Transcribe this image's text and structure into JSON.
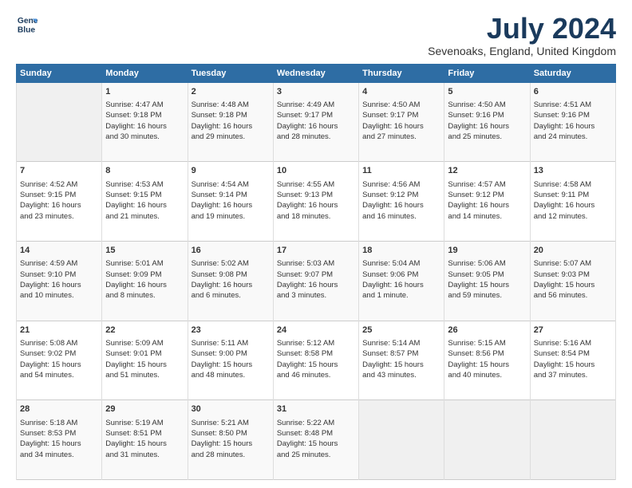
{
  "logo": {
    "line1": "General",
    "line2": "Blue"
  },
  "title": "July 2024",
  "subtitle": "Sevenoaks, England, United Kingdom",
  "header_days": [
    "Sunday",
    "Monday",
    "Tuesday",
    "Wednesday",
    "Thursday",
    "Friday",
    "Saturday"
  ],
  "weeks": [
    {
      "cells": [
        {
          "date": "",
          "content": "",
          "empty": true
        },
        {
          "date": "1",
          "content": "Sunrise: 4:47 AM\nSunset: 9:18 PM\nDaylight: 16 hours\nand 30 minutes."
        },
        {
          "date": "2",
          "content": "Sunrise: 4:48 AM\nSunset: 9:18 PM\nDaylight: 16 hours\nand 29 minutes."
        },
        {
          "date": "3",
          "content": "Sunrise: 4:49 AM\nSunset: 9:17 PM\nDaylight: 16 hours\nand 28 minutes."
        },
        {
          "date": "4",
          "content": "Sunrise: 4:50 AM\nSunset: 9:17 PM\nDaylight: 16 hours\nand 27 minutes."
        },
        {
          "date": "5",
          "content": "Sunrise: 4:50 AM\nSunset: 9:16 PM\nDaylight: 16 hours\nand 25 minutes."
        },
        {
          "date": "6",
          "content": "Sunrise: 4:51 AM\nSunset: 9:16 PM\nDaylight: 16 hours\nand 24 minutes."
        }
      ]
    },
    {
      "cells": [
        {
          "date": "7",
          "content": "Sunrise: 4:52 AM\nSunset: 9:15 PM\nDaylight: 16 hours\nand 23 minutes."
        },
        {
          "date": "8",
          "content": "Sunrise: 4:53 AM\nSunset: 9:15 PM\nDaylight: 16 hours\nand 21 minutes."
        },
        {
          "date": "9",
          "content": "Sunrise: 4:54 AM\nSunset: 9:14 PM\nDaylight: 16 hours\nand 19 minutes."
        },
        {
          "date": "10",
          "content": "Sunrise: 4:55 AM\nSunset: 9:13 PM\nDaylight: 16 hours\nand 18 minutes."
        },
        {
          "date": "11",
          "content": "Sunrise: 4:56 AM\nSunset: 9:12 PM\nDaylight: 16 hours\nand 16 minutes."
        },
        {
          "date": "12",
          "content": "Sunrise: 4:57 AM\nSunset: 9:12 PM\nDaylight: 16 hours\nand 14 minutes."
        },
        {
          "date": "13",
          "content": "Sunrise: 4:58 AM\nSunset: 9:11 PM\nDaylight: 16 hours\nand 12 minutes."
        }
      ]
    },
    {
      "cells": [
        {
          "date": "14",
          "content": "Sunrise: 4:59 AM\nSunset: 9:10 PM\nDaylight: 16 hours\nand 10 minutes."
        },
        {
          "date": "15",
          "content": "Sunrise: 5:01 AM\nSunset: 9:09 PM\nDaylight: 16 hours\nand 8 minutes."
        },
        {
          "date": "16",
          "content": "Sunrise: 5:02 AM\nSunset: 9:08 PM\nDaylight: 16 hours\nand 6 minutes."
        },
        {
          "date": "17",
          "content": "Sunrise: 5:03 AM\nSunset: 9:07 PM\nDaylight: 16 hours\nand 3 minutes."
        },
        {
          "date": "18",
          "content": "Sunrise: 5:04 AM\nSunset: 9:06 PM\nDaylight: 16 hours\nand 1 minute."
        },
        {
          "date": "19",
          "content": "Sunrise: 5:06 AM\nSunset: 9:05 PM\nDaylight: 15 hours\nand 59 minutes."
        },
        {
          "date": "20",
          "content": "Sunrise: 5:07 AM\nSunset: 9:03 PM\nDaylight: 15 hours\nand 56 minutes."
        }
      ]
    },
    {
      "cells": [
        {
          "date": "21",
          "content": "Sunrise: 5:08 AM\nSunset: 9:02 PM\nDaylight: 15 hours\nand 54 minutes."
        },
        {
          "date": "22",
          "content": "Sunrise: 5:09 AM\nSunset: 9:01 PM\nDaylight: 15 hours\nand 51 minutes."
        },
        {
          "date": "23",
          "content": "Sunrise: 5:11 AM\nSunset: 9:00 PM\nDaylight: 15 hours\nand 48 minutes."
        },
        {
          "date": "24",
          "content": "Sunrise: 5:12 AM\nSunset: 8:58 PM\nDaylight: 15 hours\nand 46 minutes."
        },
        {
          "date": "25",
          "content": "Sunrise: 5:14 AM\nSunset: 8:57 PM\nDaylight: 15 hours\nand 43 minutes."
        },
        {
          "date": "26",
          "content": "Sunrise: 5:15 AM\nSunset: 8:56 PM\nDaylight: 15 hours\nand 40 minutes."
        },
        {
          "date": "27",
          "content": "Sunrise: 5:16 AM\nSunset: 8:54 PM\nDaylight: 15 hours\nand 37 minutes."
        }
      ]
    },
    {
      "cells": [
        {
          "date": "28",
          "content": "Sunrise: 5:18 AM\nSunset: 8:53 PM\nDaylight: 15 hours\nand 34 minutes."
        },
        {
          "date": "29",
          "content": "Sunrise: 5:19 AM\nSunset: 8:51 PM\nDaylight: 15 hours\nand 31 minutes."
        },
        {
          "date": "30",
          "content": "Sunrise: 5:21 AM\nSunset: 8:50 PM\nDaylight: 15 hours\nand 28 minutes."
        },
        {
          "date": "31",
          "content": "Sunrise: 5:22 AM\nSunset: 8:48 PM\nDaylight: 15 hours\nand 25 minutes."
        },
        {
          "date": "",
          "content": "",
          "empty": true
        },
        {
          "date": "",
          "content": "",
          "empty": true
        },
        {
          "date": "",
          "content": "",
          "empty": true
        }
      ]
    }
  ]
}
